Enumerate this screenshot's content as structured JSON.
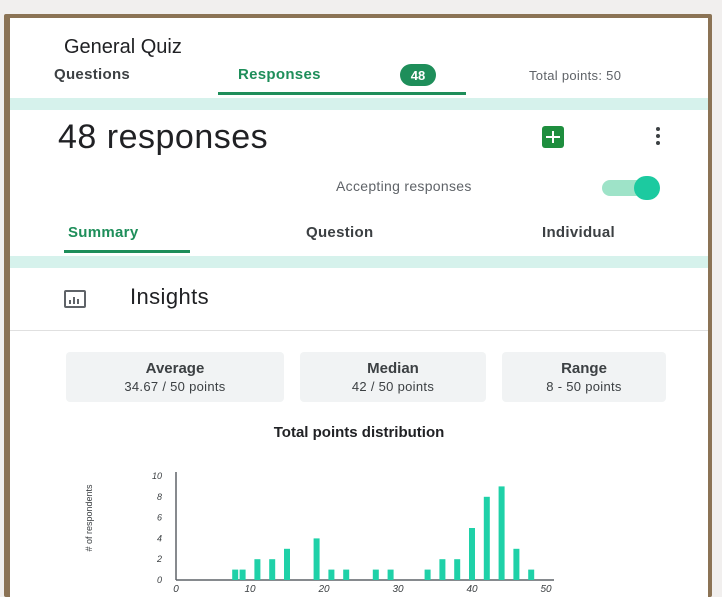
{
  "quiz_title": "General Quiz",
  "top_tabs": {
    "questions": "Questions",
    "responses": "Responses",
    "responses_badge": "48",
    "total_points": "Total points: 50"
  },
  "responses_header": {
    "count_label": "48 responses",
    "accepting_label": "Accepting responses",
    "accepting_on": true,
    "sheets_icon": "sheets-icon",
    "more_icon": "more-vert-icon"
  },
  "sub_tabs": {
    "summary": "Summary",
    "question": "Question",
    "individual": "Individual"
  },
  "insights": {
    "icon": "insights-icon",
    "label": "Insights"
  },
  "stats": {
    "average": {
      "label": "Average",
      "value": "34.67 / 50 points"
    },
    "median": {
      "label": "Median",
      "value": "42 / 50 points"
    },
    "range": {
      "label": "Range",
      "value": "8 - 50 points"
    }
  },
  "colors": {
    "accent": "#1e8e5a",
    "bar": "#1fd1a8",
    "mint": "#d6f2ec"
  },
  "chart_data": {
    "type": "bar",
    "title": "Total points distribution",
    "ylabel": "# of respondents",
    "xlabel": "",
    "ylim": [
      0,
      10
    ],
    "yticks": [
      0,
      2,
      4,
      6,
      8,
      10
    ],
    "xticks": [
      0,
      10,
      20,
      30,
      40,
      50
    ],
    "x": [
      8,
      9,
      11,
      13,
      15,
      19,
      21,
      23,
      27,
      29,
      34,
      36,
      38,
      40,
      42,
      44,
      46,
      48
    ],
    "values": [
      1,
      1,
      2,
      2,
      3,
      4,
      1,
      1,
      1,
      1,
      1,
      2,
      2,
      5,
      8,
      9,
      3,
      1
    ]
  }
}
